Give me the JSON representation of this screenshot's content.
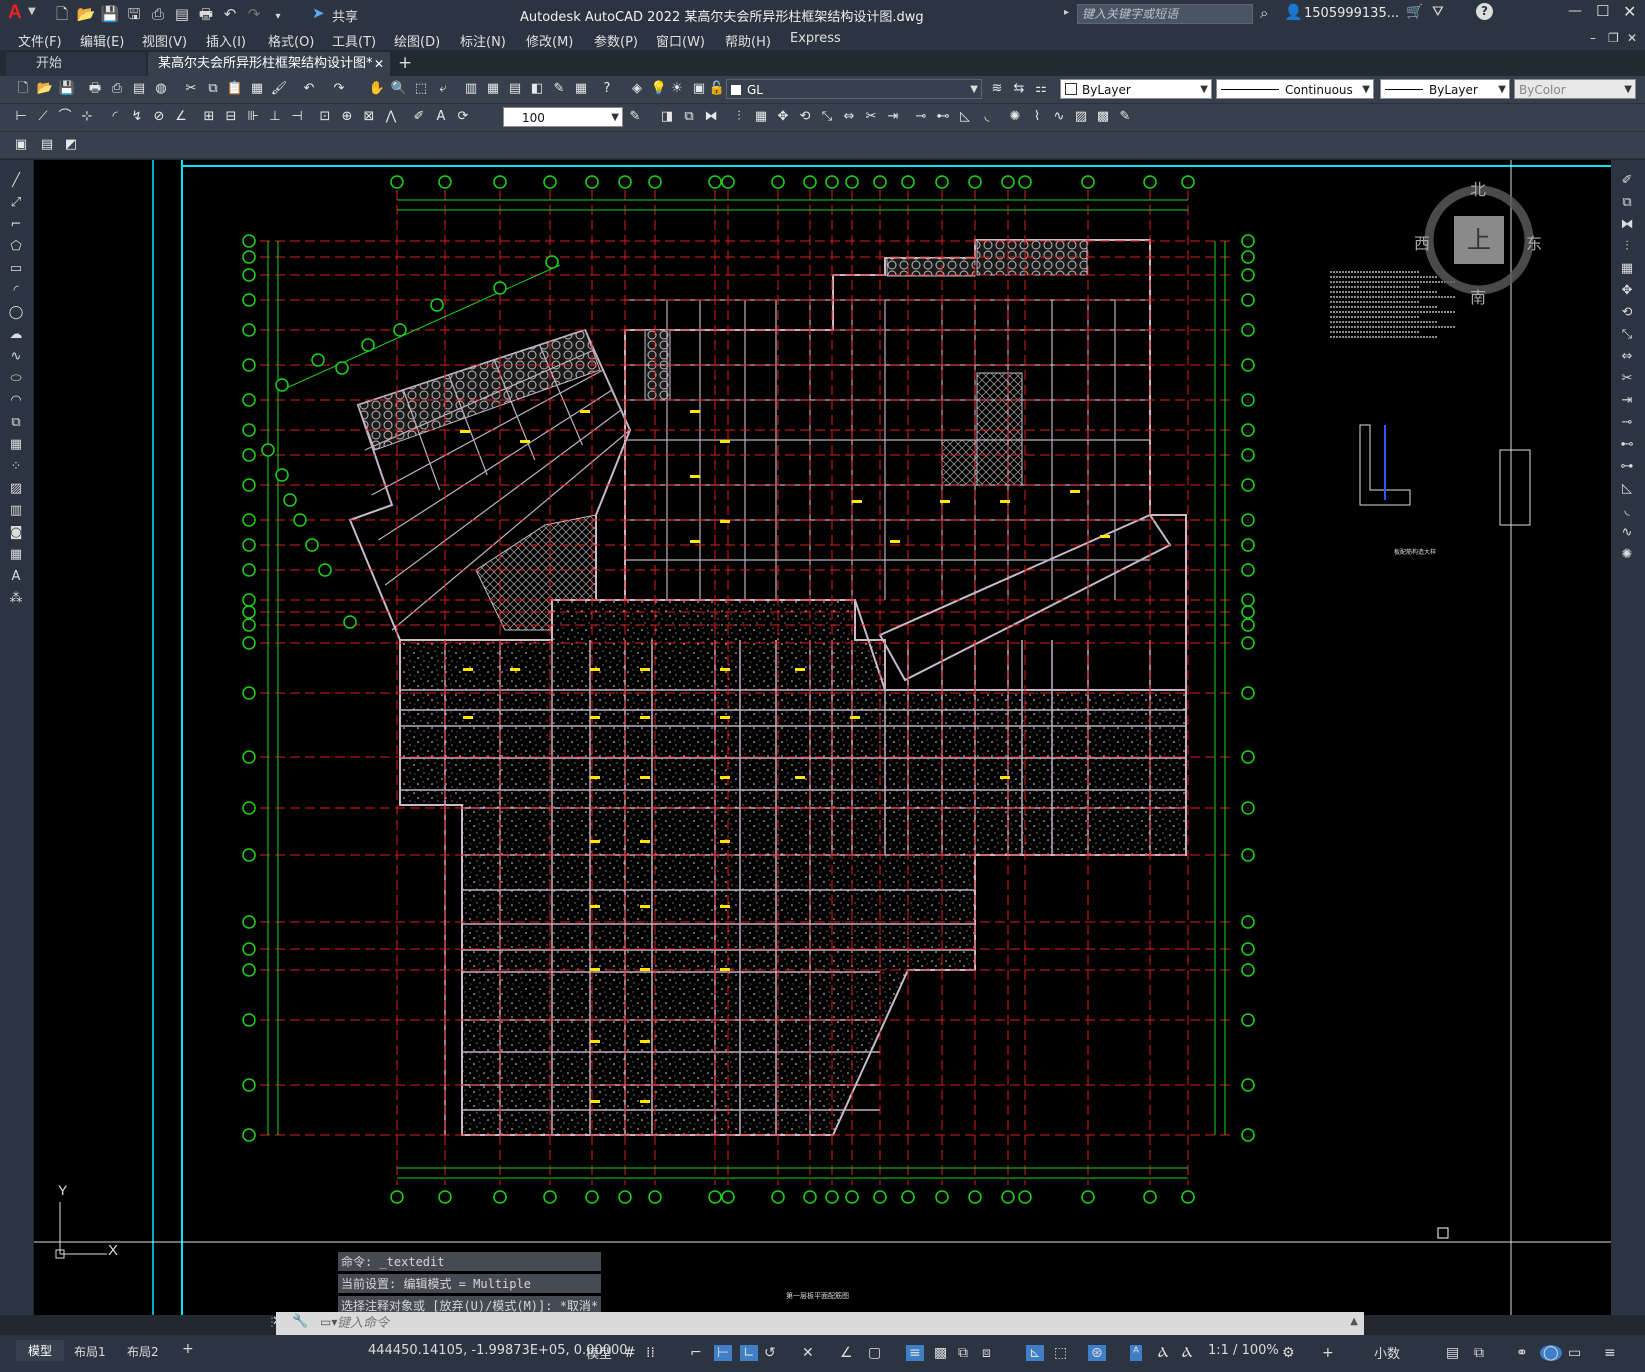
{
  "app": {
    "title": "Autodesk AutoCAD 2022    某高尔夫会所异形柱框架结构设计图.dwg",
    "share_label": "共享",
    "search_placeholder": "键入关键字或短语",
    "user": "1505999135...",
    "logo": "A"
  },
  "menu": [
    "文件(F)",
    "编辑(E)",
    "视图(V)",
    "插入(I)",
    "格式(O)",
    "工具(T)",
    "绘图(D)",
    "标注(N)",
    "修改(M)",
    "参数(P)",
    "窗口(W)",
    "帮助(H)",
    "Express"
  ],
  "tabs": [
    {
      "label": "开始",
      "active": false
    },
    {
      "label": "某高尔夫会所异形柱框架结构设计图*",
      "active": true
    }
  ],
  "toolbar": {
    "layer": "GL",
    "color": "ByLayer",
    "linetype": "Continuous",
    "lineweight": "ByLayer",
    "plotstyle": "ByColor",
    "scale": "100"
  },
  "viewcube": {
    "north": "北",
    "south": "南",
    "east": "东",
    "west": "西",
    "top": "上"
  },
  "drawing": {
    "title": "第一层板平面配筋图",
    "detail_title": "板配筋构造大样",
    "ucs_y": "Y",
    "ucs_x": "X"
  },
  "command": {
    "history": [
      "命令: _textedit",
      "当前设置: 编辑模式 = Multiple",
      "选择注释对象或 [放弃(U)/模式(M)]: *取消*"
    ],
    "placeholder": "键入命令"
  },
  "layout_tabs": [
    "模型",
    "布局1",
    "布局2"
  ],
  "status": {
    "coords": "444450.14105, -1.99873E+05, 0.00000",
    "space": "模型",
    "scale": "1:1 / 100%",
    "units": "小数"
  }
}
